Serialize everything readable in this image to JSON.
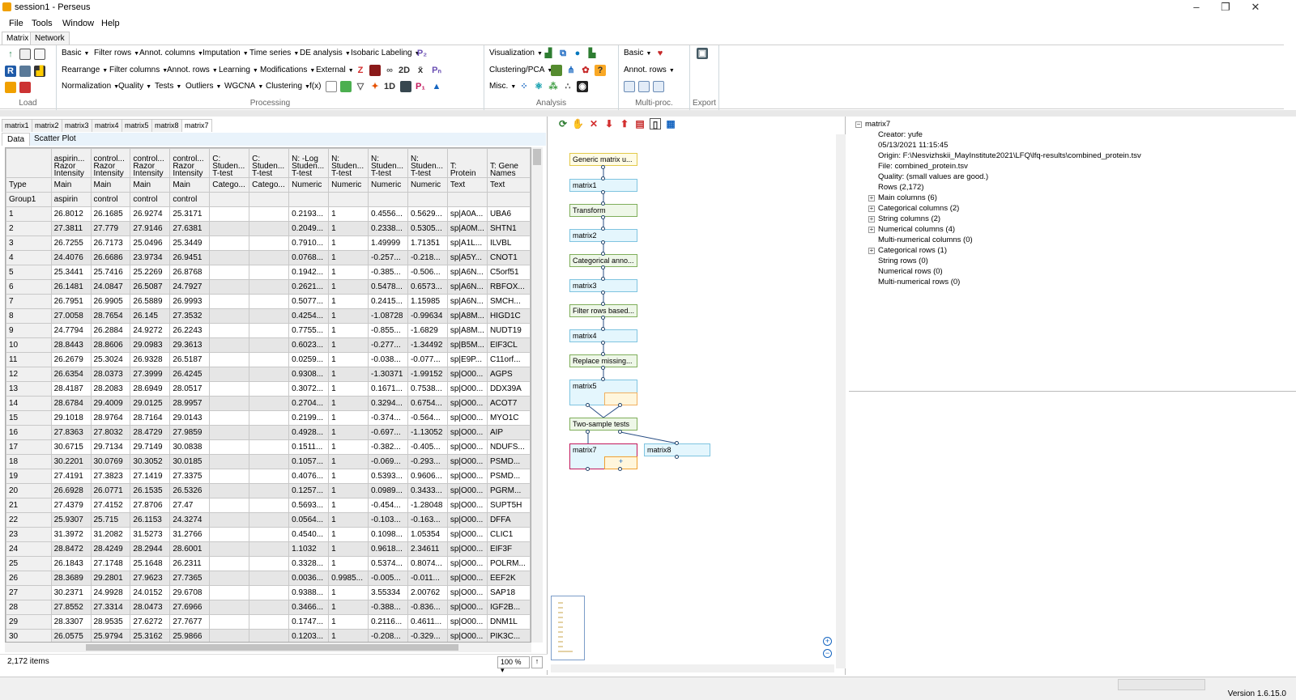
{
  "window": {
    "title": "session1  -  Perseus",
    "version": "Version 1.6.15.0"
  },
  "menu": [
    "File",
    "Tools",
    "Window",
    "Help"
  ],
  "ribbon_tabs": [
    "Matrix",
    "Network"
  ],
  "ribbon": {
    "groups": {
      "load": "Load",
      "processing": "Processing",
      "analysis": "Analysis",
      "multiproc": "Multi-proc.",
      "export": "Export"
    },
    "processing_rows": [
      [
        "Basic",
        "Filter rows",
        "Annot. columns",
        "Imputation",
        "Time series",
        "DE analysis",
        "Isobaric Labeling"
      ],
      [
        "Rearrange",
        "Filter columns",
        "Annot. rows",
        "Learning",
        "Modifications",
        "External"
      ],
      [
        "Normalization",
        "Quality",
        "Tests",
        "Outliers",
        "WGCNA",
        "Clustering"
      ]
    ],
    "processing_fx": "f(x)",
    "analysis_rows": [
      "Visualization",
      "Clustering/PCA",
      "Misc."
    ],
    "multiproc_rows": [
      "Basic",
      "Annot. rows"
    ]
  },
  "matrix_tabs": [
    "matrix1",
    "matrix2",
    "matrix3",
    "matrix4",
    "matrix5",
    "matrix8",
    "matrix7"
  ],
  "data_tabs": [
    "Data",
    "Scatter Plot"
  ],
  "table": {
    "headers": [
      "",
      "aspirin... Razor Intensity",
      "control... Razor Intensity",
      "control... Razor Intensity",
      "control... Razor Intensity",
      "C: Studen... T-test",
      "C: Studen... T-test",
      "N: -Log Studen... T-test",
      "N: Studen... T-test",
      "N: Studen... T-test",
      "N: Studen... T-test",
      "T: Protein",
      "T: Gene Names"
    ],
    "type_row": [
      "Type",
      "Main",
      "Main",
      "Main",
      "Main",
      "Catego...",
      "Catego...",
      "Numeric",
      "Numeric",
      "Numeric",
      "Numeric",
      "Text",
      "Text"
    ],
    "group_row": [
      "Group1",
      "aspirin",
      "control",
      "control",
      "control",
      "",
      "",
      "",
      "",
      "",
      "",
      "",
      ""
    ],
    "rows": [
      [
        "1",
        "26.8012",
        "26.1685",
        "26.9274",
        "25.3171",
        "",
        "",
        "0.2193...",
        "1",
        "0.4556...",
        "0.5629...",
        "sp|A0A...",
        "UBA6"
      ],
      [
        "2",
        "27.3811",
        "27.779",
        "27.9146",
        "27.6381",
        "",
        "",
        "0.2049...",
        "1",
        "0.2338...",
        "0.5305...",
        "sp|A0M...",
        "SHTN1"
      ],
      [
        "3",
        "26.7255",
        "26.7173",
        "25.0496",
        "25.3449",
        "",
        "",
        "0.7910...",
        "1",
        "1.49999",
        "1.71351",
        "sp|A1L...",
        "ILVBL"
      ],
      [
        "4",
        "24.4076",
        "26.6686",
        "23.9734",
        "26.9451",
        "",
        "",
        "0.0768...",
        "1",
        "-0.257...",
        "-0.218...",
        "sp|A5Y...",
        "CNOT1"
      ],
      [
        "5",
        "25.3441",
        "25.7416",
        "25.2269",
        "26.8768",
        "",
        "",
        "0.1942...",
        "1",
        "-0.385...",
        "-0.506...",
        "sp|A6N...",
        "C5orf51"
      ],
      [
        "6",
        "26.1481",
        "24.0847",
        "26.5087",
        "24.7927",
        "",
        "",
        "0.2621...",
        "1",
        "0.5478...",
        "0.6573...",
        "sp|A6N...",
        "RBFOX..."
      ],
      [
        "7",
        "26.7951",
        "26.9905",
        "26.5889",
        "26.9993",
        "",
        "",
        "0.5077...",
        "1",
        "0.2415...",
        "1.15985",
        "sp|A6N...",
        "SMCH..."
      ],
      [
        "8",
        "27.0058",
        "28.7654",
        "26.145",
        "27.3532",
        "",
        "",
        "0.4254...",
        "1",
        "-1.08728",
        "-0.99634",
        "sp|A8M...",
        "HIGD1C"
      ],
      [
        "9",
        "24.7794",
        "26.2884",
        "24.9272",
        "26.2243",
        "",
        "",
        "0.7755...",
        "1",
        "-0.855...",
        "-1.6829",
        "sp|A8M...",
        "NUDT19"
      ],
      [
        "10",
        "28.8443",
        "28.8606",
        "29.0983",
        "29.3613",
        "",
        "",
        "0.6023...",
        "1",
        "-0.277...",
        "-1.34492",
        "sp|B5M...",
        "EIF3CL"
      ],
      [
        "11",
        "26.2679",
        "25.3024",
        "26.9328",
        "26.5187",
        "",
        "",
        "0.0259...",
        "1",
        "-0.038...",
        "-0.077...",
        "sp|E9P...",
        "C11orf..."
      ],
      [
        "12",
        "26.6354",
        "28.0373",
        "27.3999",
        "26.4245",
        "",
        "",
        "0.9308...",
        "1",
        "-1.30371",
        "-1.99152",
        "sp|O00...",
        "AGPS"
      ],
      [
        "13",
        "28.4187",
        "28.2083",
        "28.6949",
        "28.0517",
        "",
        "",
        "0.3072...",
        "1",
        "0.1671...",
        "0.7538...",
        "sp|O00...",
        "DDX39A"
      ],
      [
        "14",
        "28.6784",
        "29.4009",
        "29.0125",
        "28.9957",
        "",
        "",
        "0.2704...",
        "1",
        "0.3294...",
        "0.6754...",
        "sp|O00...",
        "ACOT7"
      ],
      [
        "15",
        "29.1018",
        "28.9764",
        "28.7164",
        "29.0143",
        "",
        "",
        "0.2199...",
        "1",
        "-0.374...",
        "-0.564...",
        "sp|O00...",
        "MYO1C"
      ],
      [
        "16",
        "27.8363",
        "27.8032",
        "28.4729",
        "27.9859",
        "",
        "",
        "0.4928...",
        "1",
        "-0.697...",
        "-1.13052",
        "sp|O00...",
        "AIP"
      ],
      [
        "17",
        "30.6715",
        "29.7134",
        "29.7149",
        "30.0838",
        "",
        "",
        "0.1511...",
        "1",
        "-0.382...",
        "-0.405...",
        "sp|O00...",
        "NDUFS..."
      ],
      [
        "18",
        "30.2201",
        "30.0769",
        "30.3052",
        "30.0185",
        "",
        "",
        "0.1057...",
        "1",
        "-0.069...",
        "-0.293...",
        "sp|O00...",
        "PSMD..."
      ],
      [
        "19",
        "27.4191",
        "27.3823",
        "27.1419",
        "27.3375",
        "",
        "",
        "0.4076...",
        "1",
        "0.5393...",
        "0.9606...",
        "sp|O00...",
        "PSMD..."
      ],
      [
        "20",
        "26.6928",
        "26.0771",
        "26.1535",
        "26.5326",
        "",
        "",
        "0.1257...",
        "1",
        "0.0989...",
        "0.3433...",
        "sp|O00...",
        "PGRM..."
      ],
      [
        "21",
        "27.4379",
        "27.4152",
        "27.8706",
        "27.47",
        "",
        "",
        "0.5693...",
        "1",
        "-0.454...",
        "-1.28048",
        "sp|O00...",
        "SUPT5H"
      ],
      [
        "22",
        "25.9307",
        "25.715",
        "26.1153",
        "24.3274",
        "",
        "",
        "0.0564...",
        "1",
        "-0.103...",
        "-0.163...",
        "sp|O00...",
        "DFFA"
      ],
      [
        "23",
        "31.3972",
        "31.2082",
        "31.5273",
        "31.2766",
        "",
        "",
        "0.4540...",
        "1",
        "0.1098...",
        "1.05354",
        "sp|O00...",
        "CLIC1"
      ],
      [
        "24",
        "28.8472",
        "28.4249",
        "28.2944",
        "28.6001",
        "",
        "",
        "1.1032",
        "1",
        "0.9618...",
        "2.34611",
        "sp|O00...",
        "EIF3F"
      ],
      [
        "25",
        "26.1843",
        "27.1748",
        "25.1648",
        "26.2311",
        "",
        "",
        "0.3328...",
        "1",
        "0.5374...",
        "0.8074...",
        "sp|O00...",
        "POLRM..."
      ],
      [
        "26",
        "28.3689",
        "29.2801",
        "27.9623",
        "27.7365",
        "",
        "",
        "0.0036...",
        "0.9985...",
        "-0.005...",
        "-0.011...",
        "sp|O00...",
        "EEF2K"
      ],
      [
        "27",
        "30.2371",
        "24.9928",
        "24.0152",
        "29.6708",
        "",
        "",
        "0.9388...",
        "1",
        "3.55334",
        "2.00762",
        "sp|O00...",
        "SAP18"
      ],
      [
        "28",
        "27.8552",
        "27.3314",
        "28.0473",
        "27.6966",
        "",
        "",
        "0.3466...",
        "1",
        "-0.388...",
        "-0.836...",
        "sp|O00...",
        "IGF2B..."
      ],
      [
        "29",
        "28.3307",
        "28.9535",
        "27.6272",
        "27.7677",
        "",
        "",
        "0.1747...",
        "1",
        "0.2116...",
        "0.4611...",
        "sp|O00...",
        "DNM1L"
      ],
      [
        "30",
        "26.0575",
        "25.9794",
        "25.3162",
        "25.9866",
        "",
        "",
        "0.1203...",
        "1",
        "-0.208...",
        "-0.329...",
        "sp|O00...",
        "PIK3C..."
      ]
    ]
  },
  "status": {
    "items": "2,172 items",
    "zoom": "100 %",
    "zoom_up": "↑"
  },
  "workflow": {
    "nodes": [
      {
        "id": "generic",
        "label": "Generic matrix u...",
        "kind": "gen"
      },
      {
        "id": "m1",
        "label": "matrix1",
        "kind": "mat"
      },
      {
        "id": "transform",
        "label": "Transform",
        "kind": "proc"
      },
      {
        "id": "m2",
        "label": "matrix2",
        "kind": "mat"
      },
      {
        "id": "catanno",
        "label": "Categorical anno...",
        "kind": "proc"
      },
      {
        "id": "m3",
        "label": "matrix3",
        "kind": "mat"
      },
      {
        "id": "filter",
        "label": "Filter rows based...",
        "kind": "proc"
      },
      {
        "id": "m4",
        "label": "matrix4",
        "kind": "mat"
      },
      {
        "id": "replace",
        "label": "Replace missing...",
        "kind": "proc"
      },
      {
        "id": "m5",
        "label": "matrix5",
        "kind": "mat"
      },
      {
        "id": "ttest",
        "label": "Two-sample tests",
        "kind": "proc"
      },
      {
        "id": "m7",
        "label": "matrix7",
        "kind": "mat"
      },
      {
        "id": "m8",
        "label": "matrix8",
        "kind": "mat"
      }
    ]
  },
  "info_tree": {
    "root": "matrix7",
    "items": [
      "Creator: yufe",
      "05/13/2021 11:15:45",
      "Origin: F:\\Nesvizhskii_MayInstitute2021\\LFQ\\lfq-results\\combined_protein.tsv",
      "File: combined_protein.tsv",
      "Quality:  (small values are good.)",
      "Rows (2,172)",
      "Main columns (6)",
      "Categorical columns (2)",
      "String columns (2)",
      "Numerical columns (4)",
      "Multi-numerical columns (0)",
      "Categorical rows (1)",
      "String rows (0)",
      "Numerical rows (0)",
      "Multi-numerical rows (0)"
    ]
  }
}
